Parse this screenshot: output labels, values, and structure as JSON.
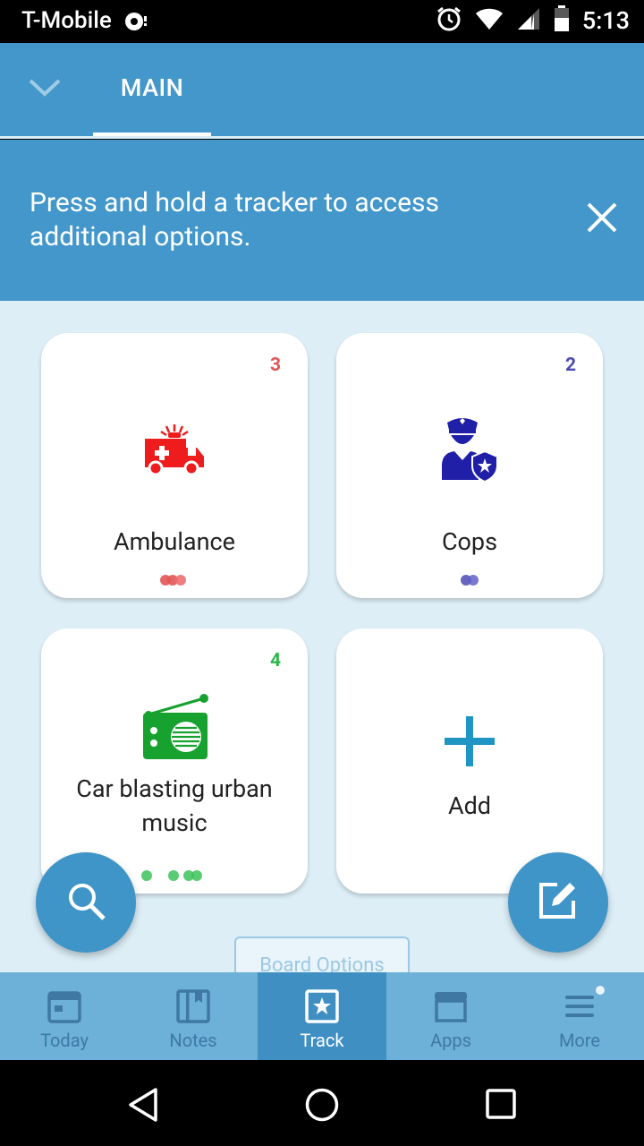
{
  "status": {
    "carrier": "T-Mobile",
    "time": "5:13"
  },
  "header": {
    "tab_main": "MAIN"
  },
  "hint": {
    "text": "Press and hold a tracker to access additional options."
  },
  "trackers": [
    {
      "title": "Ambulance",
      "count": "3",
      "color": "#e25555",
      "icon": "ambulance-icon"
    },
    {
      "title": "Cops",
      "count": "2",
      "color": "#4b4bb0",
      "icon": "police-officer-icon"
    },
    {
      "title": "Car blasting urban music",
      "count": "4",
      "color": "#2db84d",
      "icon": "radio-icon"
    }
  ],
  "add_card": {
    "label": "Add"
  },
  "board_options": {
    "label": "Board Options"
  },
  "bottom_nav": {
    "items": [
      {
        "label": "Today",
        "icon": "calendar-icon"
      },
      {
        "label": "Notes",
        "icon": "notebook-icon"
      },
      {
        "label": "Track",
        "icon": "star-box-icon"
      },
      {
        "label": "Apps",
        "icon": "store-icon"
      },
      {
        "label": "More",
        "icon": "menu-icon"
      }
    ]
  },
  "colors": {
    "primary": "#4397cb",
    "content_bg": "#ddeef7",
    "nav_bg": "#6db0d8",
    "nav_active": "#3f8fc3"
  }
}
